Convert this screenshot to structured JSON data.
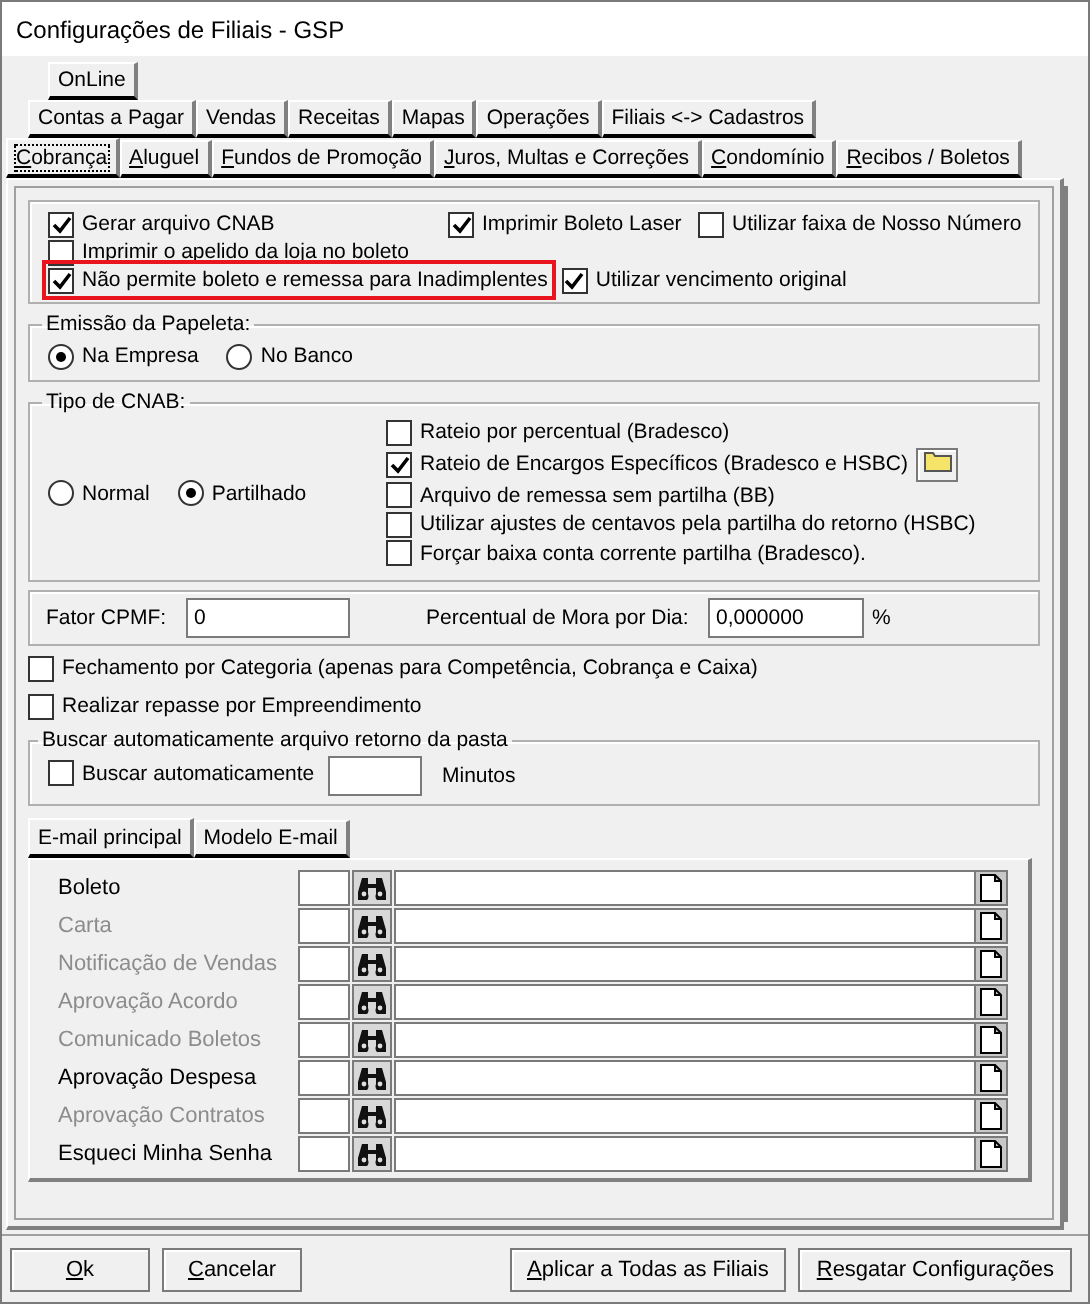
{
  "window": {
    "title": "Configurações de Filiais - GSP"
  },
  "tab_rows": [
    [
      {
        "label": "OnLine",
        "selected": false
      }
    ],
    [
      {
        "label": "Contas a Pagar",
        "selected": false
      },
      {
        "label": "Vendas",
        "selected": false
      },
      {
        "label": "Receitas",
        "selected": false
      },
      {
        "label": "Mapas",
        "selected": false
      },
      {
        "label": "Operações",
        "selected": false
      },
      {
        "label": "Filiais <-> Cadastros",
        "selected": false
      }
    ],
    [
      {
        "label": "Cobrança",
        "selected": true
      },
      {
        "label": "Aluguel",
        "selected": false
      },
      {
        "label": "Fundos de Promoção",
        "selected": false
      },
      {
        "label": "Juros, Multas e Correções",
        "selected": false
      },
      {
        "label": "Condomínio",
        "selected": false
      },
      {
        "label": "Recibos / Boletos",
        "selected": false
      }
    ]
  ],
  "options": [
    [
      {
        "label": "Gerar arquivo CNAB",
        "checked": true,
        "highlighted": false
      },
      {
        "label": "Imprimir Boleto Laser",
        "checked": true,
        "highlighted": false
      },
      {
        "label": "Utilizar faixa de Nosso Número",
        "checked": false,
        "highlighted": false
      }
    ],
    [
      {
        "label": "Imprimir o apelido da loja no boleto",
        "checked": false,
        "highlighted": false
      }
    ],
    [
      {
        "label": "Não permite boleto e remessa para Inadimplentes",
        "checked": true,
        "highlighted": true
      },
      {
        "label": "Utilizar vencimento original",
        "checked": true,
        "highlighted": false
      }
    ]
  ],
  "emissao_papeleta": {
    "title": "Emissão da Papeleta:",
    "options": [
      {
        "label": "Na Empresa",
        "selected": true
      },
      {
        "label": "No Banco",
        "selected": false
      }
    ]
  },
  "tipo_cnab": {
    "title": "Tipo de CNAB:",
    "options": [
      {
        "label": "Normal",
        "selected": false
      },
      {
        "label": "Partilhado",
        "selected": true
      }
    ],
    "checkboxes": [
      {
        "label": "Rateio por percentual (Bradesco)",
        "checked": false,
        "folder_button": false
      },
      {
        "label": "Rateio de Encargos Específicos (Bradesco e HSBC)",
        "checked": true,
        "folder_button": true
      },
      {
        "label": "Arquivo de remessa sem partilha (BB)",
        "checked": false,
        "folder_button": false
      },
      {
        "label": "Utilizar ajustes de centavos pela partilha do retorno (HSBC)",
        "checked": false,
        "folder_button": false
      },
      {
        "label": "Forçar baixa conta corrente partilha (Bradesco).",
        "checked": false,
        "folder_button": false
      }
    ]
  },
  "rates": {
    "cpmf_label": "Fator CPMF:",
    "cpmf_value": "0",
    "mora_label": "Percentual de Mora por Dia:",
    "mora_value": "0,000000",
    "mora_unit": "%"
  },
  "checkboxes": [
    {
      "label": "Fechamento por Categoria (apenas para Competência, Cobrança e Caixa)",
      "checked": false
    },
    {
      "label": "Realizar repasse por Empreendimento",
      "checked": false
    }
  ],
  "auto_fetch": {
    "title": "Buscar automaticamente arquivo retorno da pasta",
    "checkbox": {
      "label": "Buscar automaticamente",
      "checked": false
    },
    "unit": "Minutos"
  },
  "email_tabs": [
    {
      "label": "E-mail principal",
      "selected": true
    },
    {
      "label": "Modelo E-mail",
      "selected": false
    }
  ],
  "email_rows": [
    {
      "label": "Boleto",
      "disabled": false
    },
    {
      "label": "Carta",
      "disabled": true
    },
    {
      "label": "Notificação de Vendas",
      "disabled": true
    },
    {
      "label": "Aprovação Acordo",
      "disabled": true
    },
    {
      "label": "Comunicado Boletos",
      "disabled": true
    },
    {
      "label": "Aprovação Despesa",
      "disabled": false
    },
    {
      "label": "Aprovação Contratos",
      "disabled": true
    },
    {
      "label": "Esqueci Minha Senha",
      "disabled": false
    }
  ],
  "buttons": [
    [
      {
        "label": "Ok"
      },
      {
        "label": "Cancelar"
      }
    ],
    [
      {
        "label": "Aplicar a Todas as Filiais"
      },
      {
        "label": "Resgatar Configurações"
      }
    ]
  ]
}
